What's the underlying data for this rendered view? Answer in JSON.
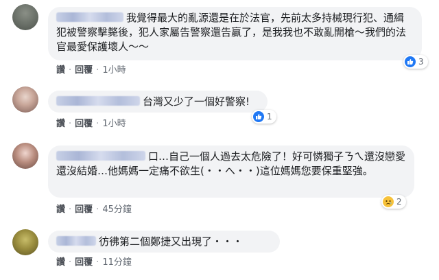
{
  "comments": [
    {
      "text": "我覺得最大的亂源還是在於法官，先前太多持械現行犯、通緝犯被警察擊斃後，犯人家屬告警察還告贏了，是我我也不敢亂開槍～我們的法官最愛保護壞人～～",
      "actions": {
        "like": "讚",
        "reply": "回覆",
        "time": "1小時"
      },
      "reaction": {
        "type": "like-icon",
        "count": "3"
      }
    },
    {
      "text": "台灣又少了一個好警察!",
      "actions": {
        "like": "讚",
        "reply": "回覆",
        "time": "1小時"
      },
      "reaction": {
        "type": "like-icon",
        "count": "1"
      }
    },
    {
      "text": "口…自己一個人過去太危險了！好可憐獨子ㄋㄟ還沒戀愛還沒結婚…他媽媽一定痛不欲生(・・へ・・)這位媽媽您要保重堅強。",
      "actions": {
        "like": "讚",
        "reply": "回覆",
        "time": "45分鐘"
      },
      "reaction": {
        "type": "sad-icon",
        "count": "2"
      }
    },
    {
      "text": "彷彿第二個鄭捷又出現了・・・",
      "actions": {
        "like": "讚",
        "reply": "回覆",
        "time": "11分鐘"
      }
    }
  ],
  "colors": {
    "bubble": "#f2f3f5",
    "link": "#4b4f56",
    "like_blue": "#2078f4",
    "sad_yellow": "#f7c23a"
  }
}
